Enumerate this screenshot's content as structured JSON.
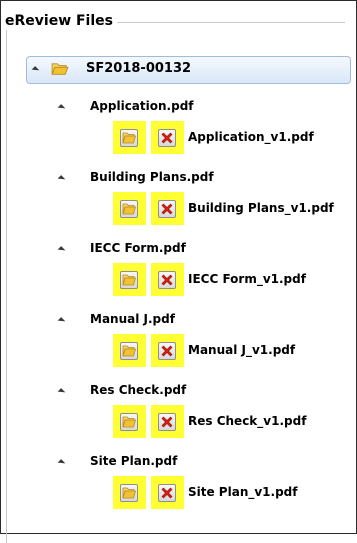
{
  "panel": {
    "title": "eReview Files"
  },
  "root": {
    "label": "SF2018-00132"
  },
  "documents": [
    {
      "label": "Application.pdf",
      "version": "Application_v1.pdf"
    },
    {
      "label": "Building Plans.pdf",
      "version": "Building Plans_v1.pdf"
    },
    {
      "label": "IECC Form.pdf",
      "version": "IECC Form_v1.pdf"
    },
    {
      "label": "Manual J.pdf",
      "version": "Manual J_v1.pdf"
    },
    {
      "label": "Res Check.pdf",
      "version": "Res Check_v1.pdf"
    },
    {
      "label": "Site Plan.pdf",
      "version": "Site Plan_v1.pdf"
    }
  ],
  "colors": {
    "highlight": "#ffff33",
    "selection": "#d9e7f8",
    "delete": "#e02010",
    "folder": "#f2c232"
  },
  "icons": [
    "expand-triangle-icon",
    "folder-open-icon",
    "delete-x-icon"
  ]
}
